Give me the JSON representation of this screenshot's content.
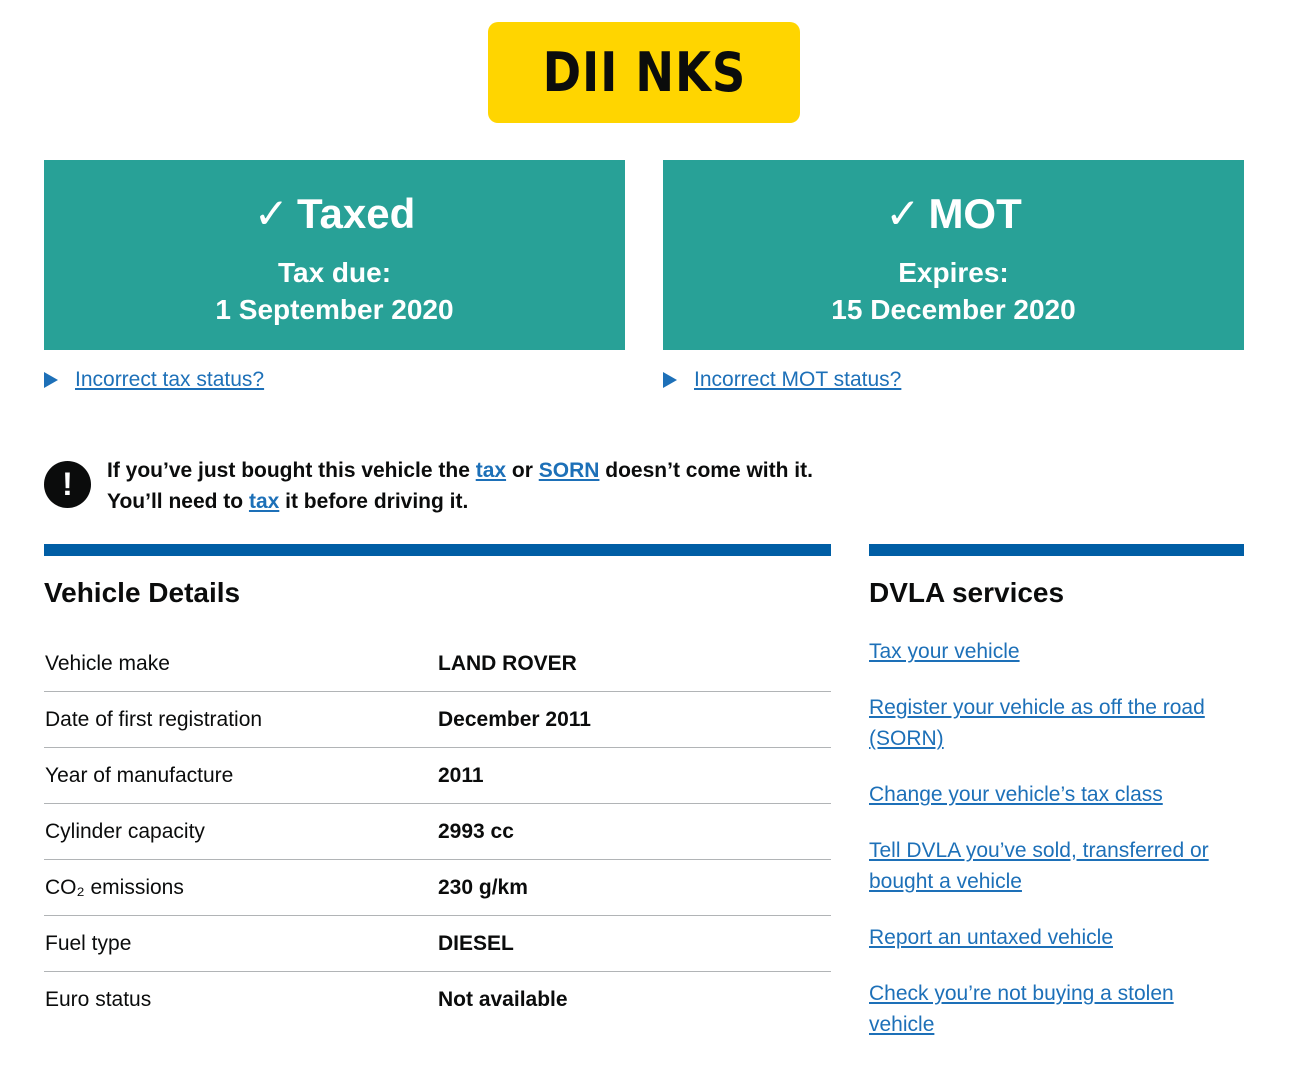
{
  "registration_plate": "DII NKS",
  "tax_panel": {
    "check": "✓",
    "title": "Taxed",
    "sub_label": "Tax due:",
    "sub_value": "1 September 2020"
  },
  "mot_panel": {
    "check": "✓",
    "title": "MOT",
    "sub_label": "Expires:",
    "sub_value": "15 December 2020"
  },
  "tax_help_link": "Incorrect tax status?",
  "mot_help_link": "Incorrect MOT status?",
  "warning": {
    "icon": "!",
    "text_1": "If you’ve just bought this vehicle the ",
    "link_tax": "tax",
    "text_2": " or ",
    "link_sorn": "SORN",
    "text_3": " doesn’t come with it. You’ll need to ",
    "link_tax_2": "tax",
    "text_4": " it before driving it."
  },
  "vehicle_details": {
    "heading": "Vehicle Details",
    "rows": [
      {
        "label": "Vehicle make",
        "value": "LAND ROVER"
      },
      {
        "label": "Date of first registration",
        "value": "December 2011"
      },
      {
        "label": "Year of manufacture",
        "value": "2011"
      },
      {
        "label": "Cylinder capacity",
        "value": "2993 cc"
      },
      {
        "label": "CO₂ emissions",
        "value": "230 g/km"
      },
      {
        "label": "Fuel type",
        "value": "DIESEL"
      },
      {
        "label": "Euro status",
        "value": "Not available"
      }
    ]
  },
  "dvla_services": {
    "heading": "DVLA services",
    "links": [
      "Tax your vehicle",
      "Register your vehicle as off the road (SORN)",
      "Change your vehicle’s tax class",
      "Tell DVLA you’ve sold, transferred or bought a vehicle",
      "Report an untaxed vehicle",
      "Check you’re not buying a stolen vehicle"
    ]
  },
  "colors": {
    "plate_yellow": "#ffd500",
    "status_green": "#28a197",
    "link_blue": "#1d70b8",
    "section_blue": "#005ea5"
  }
}
